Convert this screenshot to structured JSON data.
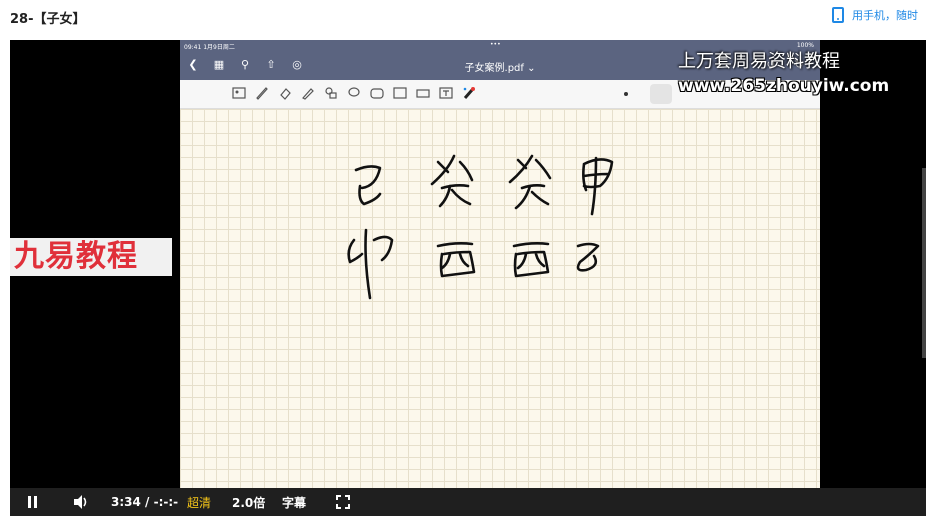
{
  "header": {
    "title": "28-【子女】",
    "mobile_link": "用手机，随时"
  },
  "ipad": {
    "status_time": "09:41  1月9日周二",
    "status_center": "•••",
    "status_right": "100%",
    "doc_title": "子女案例.pdf ⌄"
  },
  "handwriting": {
    "row1": [
      "己",
      "癸",
      "癸",
      "甲"
    ],
    "row2": [
      "卯",
      "酉",
      "酉",
      "子"
    ]
  },
  "watermarks": {
    "cn": "上万套周易资料教程",
    "url": "www.265zhouyiw.com",
    "brand": "九易教程"
  },
  "controls": {
    "time": "3:34 / -:-:-",
    "quality": "超清",
    "speed": "2.0倍",
    "subtitle": "字幕"
  },
  "colors": {
    "accent": "#1e88e5",
    "quality": "#f5c518",
    "brand": "#e0303a",
    "ipad_bar": "#5b6480"
  },
  "icons": [
    "phone-icon",
    "pause-icon",
    "volume-icon",
    "fullscreen-icon",
    "back-icon",
    "grid-icon",
    "search-icon",
    "share-icon",
    "mic-icon"
  ]
}
